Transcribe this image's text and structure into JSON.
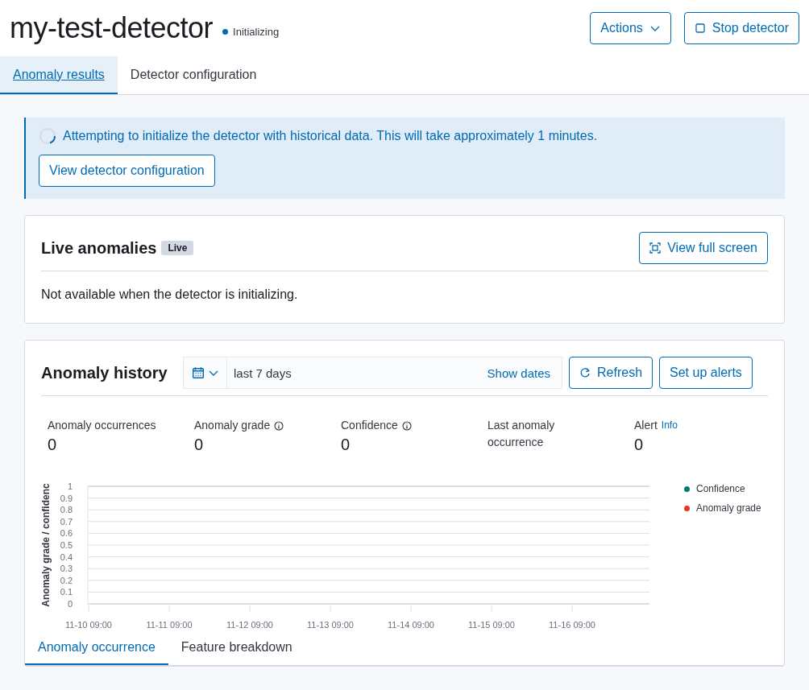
{
  "header": {
    "title": "my-test-detector",
    "status": {
      "label": "Initializing",
      "color": "#006bb4"
    },
    "buttons": [
      {
        "label": "Actions",
        "kind": "dropdown"
      },
      {
        "label": "Stop detector",
        "kind": "stop"
      }
    ]
  },
  "tabs": [
    {
      "label": "Anomaly results",
      "selected": true
    },
    {
      "label": "Detector configuration",
      "selected": false
    }
  ],
  "callout": {
    "message": "Attempting to initialize the detector with historical data. This will take approximately 1 minutes.",
    "button": "View detector configuration"
  },
  "live_anomalies": {
    "title": "Live anomalies",
    "badge": "Live",
    "button": "View full screen",
    "message": "Not available when the detector is initializing."
  },
  "anomaly_history": {
    "title": "Anomaly history",
    "date_picker": {
      "value": "last 7 days",
      "toggle": "Show dates"
    },
    "buttons": [
      {
        "label": "Refresh",
        "kind": "refresh"
      },
      {
        "label": "Set up alerts",
        "kind": "plain"
      }
    ],
    "stats": [
      {
        "label": "Anomaly occurrences",
        "value": "0",
        "kind": "plain"
      },
      {
        "label": "Anomaly grade",
        "value": "0",
        "kind": "info"
      },
      {
        "label": "Confidence",
        "value": "0",
        "kind": "info"
      },
      {
        "label": "Last anomaly occurrence",
        "kind": "plain"
      },
      {
        "label": "Alert",
        "value": "0",
        "kind": "link",
        "link": "Info"
      }
    ],
    "chart_data": {
      "type": "line",
      "ylabel": "Anomaly grade / confidenc",
      "categories": [
        "11-10 09:00",
        "11-11 09:00",
        "11-12 09:00",
        "11-13 09:00",
        "11-14 09:00",
        "11-15 09:00",
        "11-16 09:00"
      ],
      "series": [
        {
          "name": "Confidence",
          "color": "#017d73",
          "values": [
            null,
            null,
            null,
            null,
            null,
            null,
            null
          ]
        },
        {
          "name": "Anomaly grade",
          "color": "#e7351e",
          "values": [
            null,
            null,
            null,
            null,
            null,
            null,
            null
          ]
        }
      ],
      "grid": true,
      "ylim": [
        0,
        1
      ],
      "yticks": [
        0,
        0.1,
        0.2,
        0.3,
        0.4,
        0.5,
        0.6,
        0.7,
        0.8,
        0.9,
        1
      ]
    },
    "sub_tabs": [
      {
        "label": "Anomaly occurrence",
        "selected": true
      },
      {
        "label": "Feature breakdown",
        "selected": false
      }
    ]
  }
}
